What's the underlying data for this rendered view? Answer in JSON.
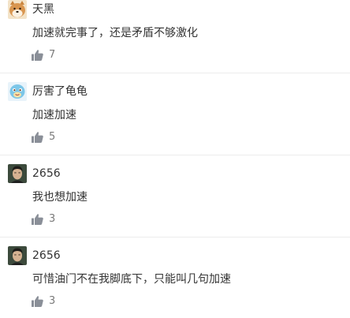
{
  "comments": [
    {
      "username": "天黑",
      "text": "加速就完事了，还是矛盾不够激化",
      "likes": "7",
      "avatar_icon": "shiba-dog-avatar"
    },
    {
      "username": "厉害了龟龟",
      "text": "加速加速",
      "likes": "5",
      "avatar_icon": "squirtle-avatar"
    },
    {
      "username": "2656",
      "text": "我也想加速",
      "likes": "3",
      "avatar_icon": "man-portrait-avatar"
    },
    {
      "username": "2656",
      "text": "可惜油门不在我脚底下，只能叫几句加速",
      "likes": "3",
      "avatar_icon": "man-portrait-avatar"
    }
  ],
  "colors": {
    "text": "#333333",
    "muted": "#7a7a7a",
    "like_icon": "#8a8f98",
    "divider": "#ececec"
  }
}
